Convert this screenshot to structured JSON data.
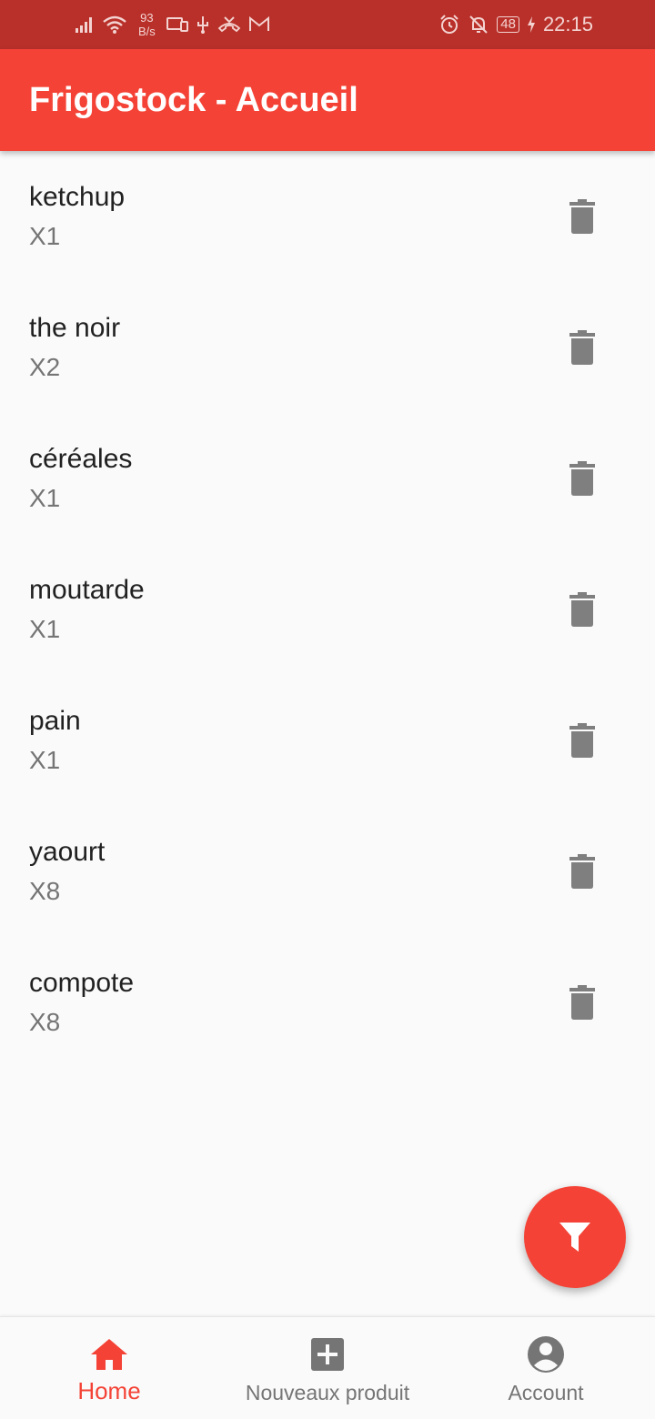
{
  "status_bar": {
    "speed_value": "93",
    "speed_unit": "B/s",
    "battery": "48",
    "time": "22:15",
    "icons_left": [
      "signal-icon",
      "wifi-icon",
      "cast-icon",
      "usb-icon",
      "missed-call-icon",
      "gmail-icon"
    ],
    "icons_right": [
      "alarm-icon",
      "notifications-off-icon",
      "battery-icon",
      "charging-icon"
    ]
  },
  "app_bar": {
    "title": "Frigostock - Accueil"
  },
  "products": [
    {
      "name": "ketchup",
      "qty": "X1"
    },
    {
      "name": "the noir",
      "qty": "X2"
    },
    {
      "name": "céréales",
      "qty": "X1"
    },
    {
      "name": "moutarde",
      "qty": "X1"
    },
    {
      "name": "pain",
      "qty": "X1"
    },
    {
      "name": "yaourt",
      "qty": "X8"
    },
    {
      "name": "compote",
      "qty": "X8"
    }
  ],
  "fab": {
    "icon": "filter-icon"
  },
  "bottom_nav": {
    "items": [
      {
        "label": "Home",
        "icon": "home-icon",
        "active": true
      },
      {
        "label": "Nouveaux produit",
        "icon": "add-box-icon",
        "active": false
      },
      {
        "label": "Account",
        "icon": "account-circle-icon",
        "active": false
      }
    ]
  },
  "colors": {
    "primary": "#f44336",
    "status_bar": "#b9302a",
    "icon_grey": "#7f7f7f"
  }
}
